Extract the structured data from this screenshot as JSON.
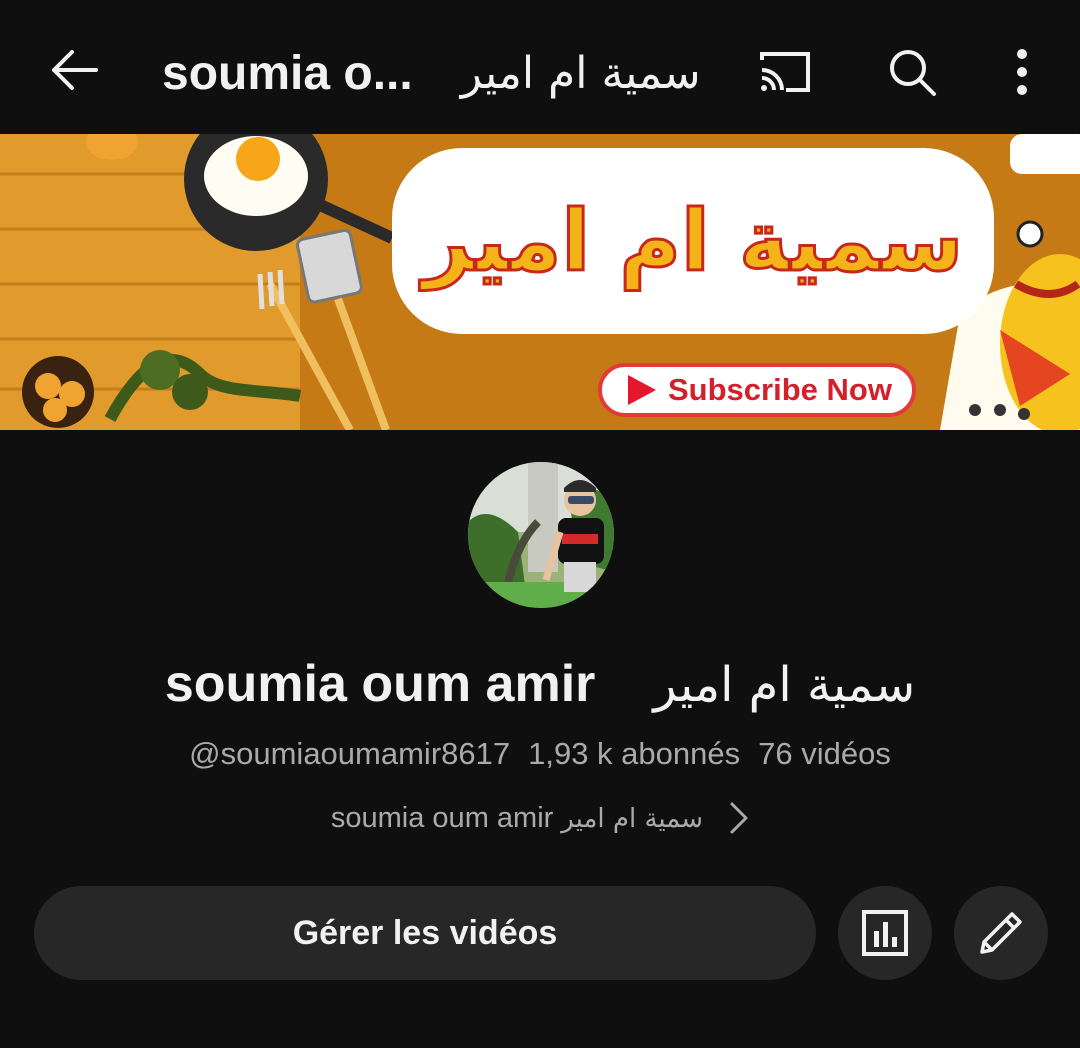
{
  "appbar": {
    "title_latin": "soumia o...",
    "title_arabic": "سمية ام امير",
    "back_icon": "arrow-left-icon",
    "cast_icon": "cast-icon",
    "search_icon": "search-icon",
    "more_icon": "more-vertical-icon"
  },
  "banner": {
    "arabic_title": "سمية ام امير",
    "subscribe_label": "Subscribe Now",
    "colors": {
      "background": "#c57a16",
      "title_fill": "#f5b31a",
      "title_outline": "#c8281a",
      "subscribe_red": "#e4172b"
    }
  },
  "channel": {
    "name_latin": "soumia oum amir",
    "name_arabic": "سمية ام امير",
    "handle": "@soumiaoumamir8617",
    "subscribers": "1,93 k abonnés",
    "videos": "76 vidéos",
    "description_latin": "soumia oum amir",
    "description_arabic": "سمية ام امير"
  },
  "actions": {
    "manage_label": "Gérer les vidéos",
    "analytics_icon": "analytics-bar-chart-icon",
    "edit_icon": "pencil-icon"
  }
}
